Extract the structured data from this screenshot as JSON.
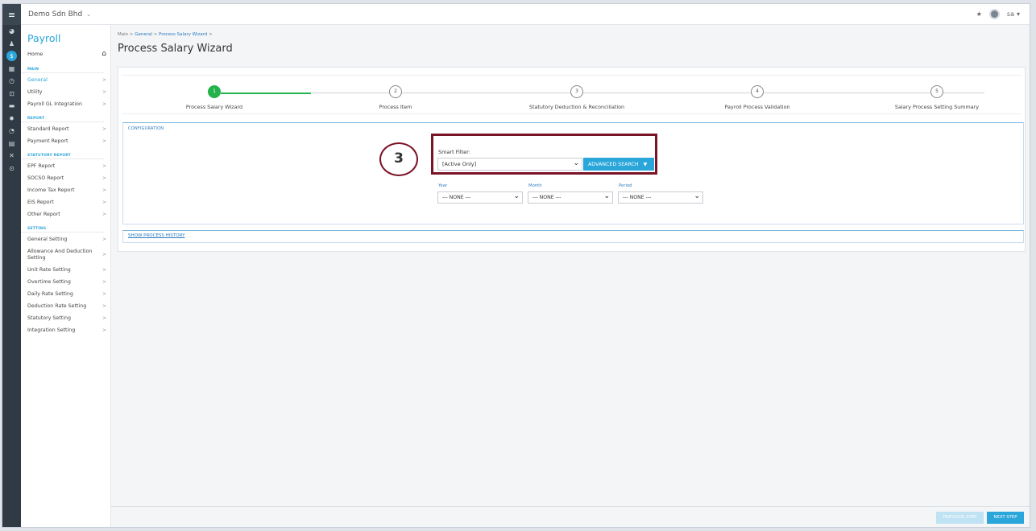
{
  "topbar": {
    "company": "Demo Sdn Bhd",
    "company_chevron": "⌄",
    "star": "★",
    "user": "sa",
    "user_caret": "▾"
  },
  "sidebar": {
    "title": "Payroll",
    "home": "Home",
    "sections": {
      "main": "MAIN",
      "report": "REPORT",
      "statutory": "STATUTORY REPORT",
      "setting": "SETTING"
    },
    "main_items": [
      "General",
      "Utility",
      "Payroll GL Integration"
    ],
    "report_items": [
      "Standard Report",
      "Payment Report"
    ],
    "statutory_items": [
      "EPF Report",
      "SOCSO Report",
      "Income Tax Report",
      "EIS Report",
      "Other Report"
    ],
    "setting_items": [
      "General Setting",
      "Allowance And Deduction Setting",
      "Unit Rate Setting",
      "Overtime Setting",
      "Daily Rate Setting",
      "Deduction Rate Setting",
      "Statutory Setting",
      "Integration Setting"
    ],
    "arrow": ">"
  },
  "breadcrumb": {
    "main": "Main",
    "sep": ">",
    "general": "General",
    "wizard": "Process Salary Wizard"
  },
  "page_title": "Process Salary Wizard",
  "wizard": {
    "steps": [
      {
        "num": "1",
        "label": "Process Salary Wizard"
      },
      {
        "num": "2",
        "label": "Process Item"
      },
      {
        "num": "3",
        "label": "Statutory Deduction & Reconciliation"
      },
      {
        "num": "4",
        "label": "Payroll Process Validation"
      },
      {
        "num": "5",
        "label": "Salary Process Setting Summary"
      }
    ],
    "current_step": 1
  },
  "configuration": {
    "header": "CONFIGURATION",
    "annotation": "3",
    "smart_filter_label": "Smart Filter:",
    "smart_filter_value": "[Active Only]",
    "advanced_search": "ADVANCED SEARCH",
    "year_label": "Year",
    "month_label": "Month",
    "period_label": "Period",
    "year_value": "--- NONE ---",
    "month_value": "--- NONE ---",
    "period_value": "--- NONE ---"
  },
  "history_link": "SHOW PROCESS HISTORY",
  "footer": {
    "previous": "PREVIOUS STEP",
    "next": "NEXT STEP"
  },
  "colors": {
    "accent": "#2aa6da",
    "done": "#24b24b",
    "annotation": "#7a1326",
    "rail": "#2f3a44"
  },
  "rail_icons": [
    "menu-icon",
    "dashboard-icon",
    "people-icon",
    "payroll-icon",
    "calendar-icon",
    "clock-icon",
    "lock-icon",
    "car-icon",
    "gear-icon",
    "chart-icon",
    "calculator-icon",
    "tools-icon",
    "settings-icon"
  ]
}
